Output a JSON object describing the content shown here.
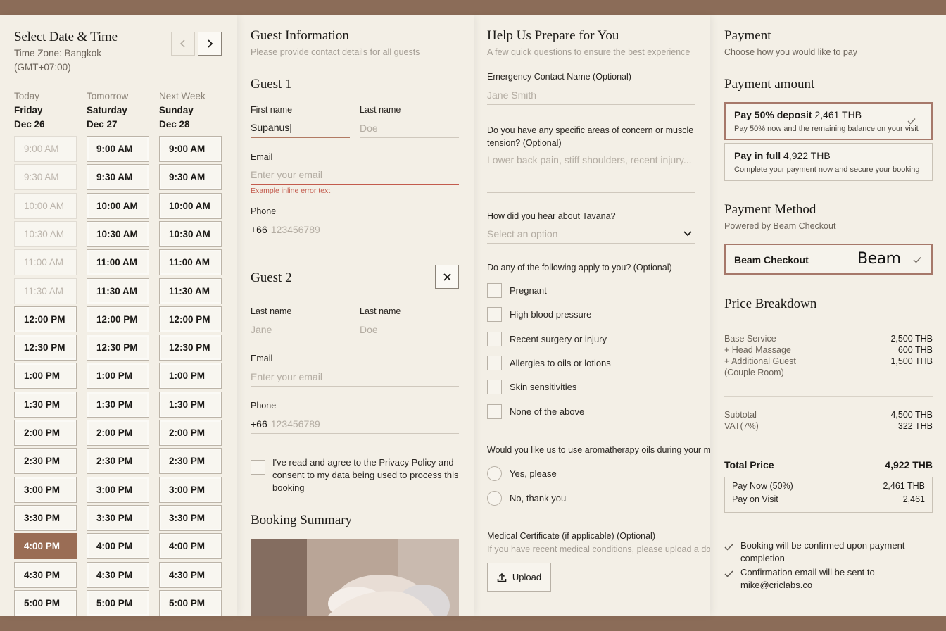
{
  "datetime": {
    "title": "Select Date & Time",
    "timezone_line1": "Time Zone: Bangkok",
    "timezone_line2": "(GMT+07:00)",
    "prev_icon": "chevron-left-icon",
    "next_icon": "chevron-right-icon",
    "columns": [
      {
        "rel": "Today",
        "day": "Friday",
        "date": "Dec 26"
      },
      {
        "rel": "Tomorrow",
        "day": "Saturday",
        "date": "Dec 27"
      },
      {
        "rel": "Next Week",
        "day": "Sunday",
        "date": "Dec 28"
      }
    ],
    "slots": [
      "9:00 AM",
      "9:30 AM",
      "10:00 AM",
      "10:30 AM",
      "11:00 AM",
      "11:30 AM",
      "12:00 PM",
      "12:30 PM",
      "1:00 PM",
      "1:30 PM",
      "2:00 PM",
      "2:30 PM",
      "3:00 PM",
      "3:30 PM",
      "4:00 PM",
      "4:30 PM",
      "5:00 PM"
    ],
    "disabled_today_count": 6,
    "selected": {
      "column": 0,
      "slot": 14
    }
  },
  "guest": {
    "title": "Guest Information",
    "subtitle": "Please provide contact details for all guests",
    "g1": {
      "title": "Guest 1",
      "first_label": "First name",
      "first_value": "Supanus|",
      "last_label": "Last name",
      "last_placeholder": "Doe",
      "email_label": "Email",
      "email_placeholder": "Enter your email",
      "error": "Example inline error text",
      "phone_label": "Phone",
      "phone_code": "+66",
      "phone_placeholder": "123456789"
    },
    "g2": {
      "title": "Guest 2",
      "close_icon": "close-icon",
      "first_label": "Last name",
      "first_placeholder": "Jane",
      "last_label": "Last name",
      "last_placeholder": "Doe",
      "email_label": "Email",
      "email_placeholder": "Enter your email",
      "phone_label": "Phone",
      "phone_code": "+66",
      "phone_placeholder": "123456789"
    },
    "consent": "I've read and agree to the Privacy Policy and consent to my data being used to process this booking",
    "summary_title": "Booking Summary"
  },
  "prepare": {
    "title": "Help Us Prepare for You",
    "subtitle": "A few quick questions to ensure the best experience",
    "emergency_label": "Emergency Contact Name (Optional)",
    "emergency_placeholder": "Jane Smith",
    "concern_label": "Do you have any specific areas of concern or muscle tension? (Optional)",
    "concern_placeholder": "Lower back pain, stiff shoulders, recent injury...",
    "hear_label": "How did you hear about Tavana?",
    "hear_placeholder": "Select an option",
    "apply_label": "Do any of the following apply to you? (Optional)",
    "apply_options": [
      "Pregnant",
      "High blood pressure",
      "Recent surgery or injury",
      "Allergies to oils or lotions",
      "Skin sensitivities",
      "None of the above"
    ],
    "aroma_label": "Would you like us to use aromatherapy oils during your m",
    "aroma_options": [
      "Yes, please",
      "No, thank you"
    ],
    "cert_label": "Medical Certificate (if applicable) (Optional)",
    "cert_help": "If you have recent medical conditions, please upload a do",
    "upload_label": "Upload"
  },
  "payment": {
    "title": "Payment",
    "subtitle": "Choose how you would like to pay",
    "amount_title": "Payment amount",
    "deposit": {
      "bold": "Pay 50% deposit",
      "amount": "2,461 THB",
      "sub": "Pay 50% now and the remaining balance on your visit"
    },
    "full": {
      "bold": "Pay in full",
      "amount": "4,922 THB",
      "sub": "Complete your payment now and secure your booking"
    },
    "method_title": "Payment Method",
    "method_sub": "Powered by Beam Checkout",
    "beam_label": "Beam Checkout",
    "beam_logo": "Beam",
    "breakdown_title": "Price Breakdown",
    "lines": [
      {
        "label": "Base Service",
        "value": "2,500 THB"
      },
      {
        "label": "+ Head Massage",
        "value": "600 THB"
      },
      {
        "label": "+ Additional Guest",
        "value": "1,500 THB"
      }
    ],
    "couple_room": "(Couple Room)",
    "subtotal_label": "Subtotal",
    "subtotal_value": "4,500 THB",
    "vat_label": "VAT(7%)",
    "vat_value": "322 THB",
    "total_label": "Total Price",
    "total_value": "4,922 THB",
    "pay_now_label": "Pay Now (50%)",
    "pay_now_value": "2,461 THB",
    "pay_visit_label": "Pay on Visit",
    "pay_visit_value": "2,461",
    "note1": "Booking will be confirmed upon payment completion",
    "note2": "Confirmation email will be sent to mike@criclabs.co"
  }
}
